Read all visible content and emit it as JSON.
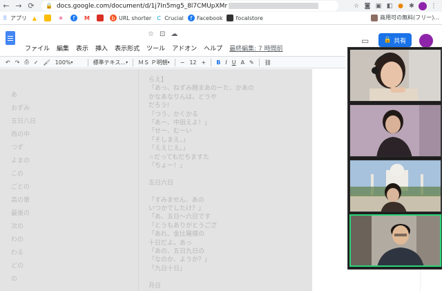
{
  "browser": {
    "url": "docs.google.com/document/d/1j7In5mg5_8l7CMUpXMr",
    "bookmarks": [
      {
        "label": "アプリ",
        "icon": "apps-icon"
      },
      {
        "label": "",
        "icon": "drive-icon"
      },
      {
        "label": "",
        "icon": "keep-icon"
      },
      {
        "label": "",
        "icon": "slack-icon"
      },
      {
        "label": "",
        "icon": "facebook-icon"
      },
      {
        "label": "",
        "icon": "gmail-icon"
      },
      {
        "label": "",
        "icon": "red-icon"
      },
      {
        "label": "URL shorter",
        "icon": "url-shorter-icon"
      },
      {
        "label": "Crucial",
        "icon": "crucial-icon"
      },
      {
        "label": "Facebook",
        "icon": "facebook-icon"
      },
      {
        "label": "focalstore",
        "icon": "focalstore-icon"
      }
    ],
    "bookmark_right": "商用可の無料(フリー)..."
  },
  "docs": {
    "menu": [
      "ファイル",
      "編集",
      "表示",
      "挿入",
      "表示形式",
      "ツール",
      "アドオン",
      "ヘルプ"
    ],
    "last_edit": "最終編集: 7 時間前",
    "share_label": "共有"
  },
  "toolbar": {
    "zoom": "100%",
    "style": "標準テキス...",
    "font": "ＭＳ Ｐ明朝",
    "size": "12",
    "bold": "B",
    "italic": "I",
    "underline": "U",
    "color": "A"
  },
  "outline": {
    "items": [
      "あ",
      "おずみ",
      "五日八日",
      "西の中",
      "つず",
      "よまの",
      "この",
      "ごとの",
      "高の第",
      "最後の",
      "次の",
      "わの",
      "わる",
      "どの",
      "の"
    ]
  },
  "document": {
    "lines": [
      "らえ】",
      "「あっ、ねずみ腕まあのーた、かあの",
      "かなあなりんは。どうや",
      "だろう!",
      "「つう、かくかる",
      "「あー、中田えよ！」",
      "「せー、むーい",
      "「そしまえ、」",
      "「ええじえ。」",
      "☆だってもだちますた",
      "「ちょー！」",
      "",
      "五日六日",
      "",
      "「すみません、あの",
      "いつかでしたけ？」",
      "「あ、五日〜六日です",
      "「とうもありがとうござ",
      "「あれ、金比羅様の",
      "十日だよ。あっ",
      "「あの、五日九日の",
      "「なのか、ようか？」",
      "「九日十日」",
      "",
      "月日"
    ]
  },
  "video": {
    "participants": 4
  },
  "colors": {
    "share": "#1a73e8",
    "active_speaker": "#2bd37a"
  }
}
